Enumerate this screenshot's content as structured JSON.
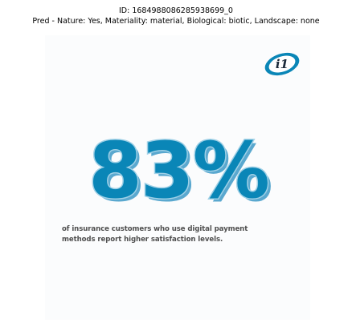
{
  "header": {
    "id_line": "ID: 1684988086285938699_0",
    "pred_line": "Pred - Nature: Yes, Materiality: material, Biological: biotic, Landscape: none"
  },
  "logo": {
    "text": "i1",
    "icon": "i1-logo-icon"
  },
  "stat": {
    "value": "83%"
  },
  "caption": {
    "line1": "of insurance customers who use digital payment",
    "line2": "methods report higher satisfaction levels."
  },
  "colors": {
    "primary_blue": "#0a86b7",
    "shadow_blue": "#5aa8cf",
    "light_blue": "#9fd0e6",
    "caption_gray": "#4f4f4f"
  }
}
